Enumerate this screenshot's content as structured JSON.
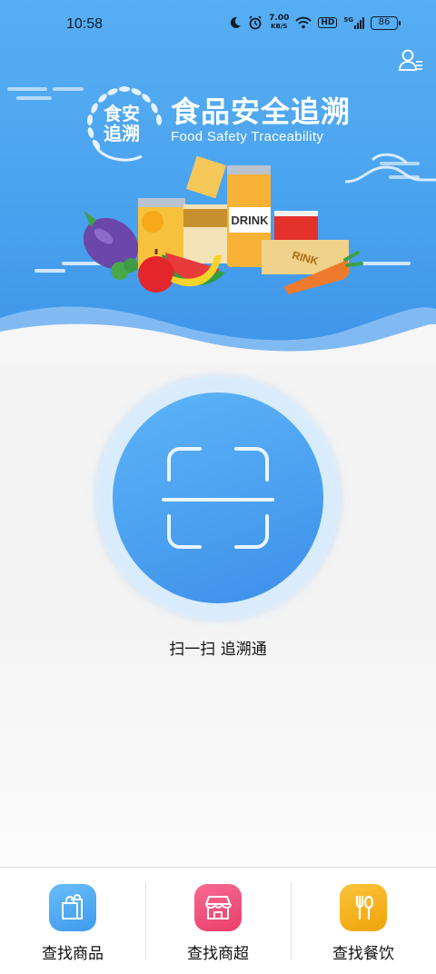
{
  "status_bar": {
    "time": "10:58",
    "net_speed_value": "7.00",
    "net_speed_unit": "KB/S",
    "hd_label": "HD",
    "signal_label": "5G",
    "battery_level": "86"
  },
  "banner": {
    "title": "食品安全追溯",
    "subtitle": "Food Safety Traceability",
    "emblem_text_top": "食安",
    "emblem_text_bottom": "追溯",
    "illustration_can_label": "DRINK",
    "illustration_box_label": "RINK"
  },
  "scan": {
    "caption": "扫一扫 追溯通"
  },
  "bottom_nav": {
    "items": [
      {
        "label": "查找商品",
        "color": "#4aa8f2",
        "icon": "shopping-bag-icon"
      },
      {
        "label": "查找商超",
        "color": "#f0507a",
        "icon": "storefront-icon"
      },
      {
        "label": "查找餐饮",
        "color": "#f5b014",
        "icon": "fork-spoon-icon"
      }
    ]
  }
}
